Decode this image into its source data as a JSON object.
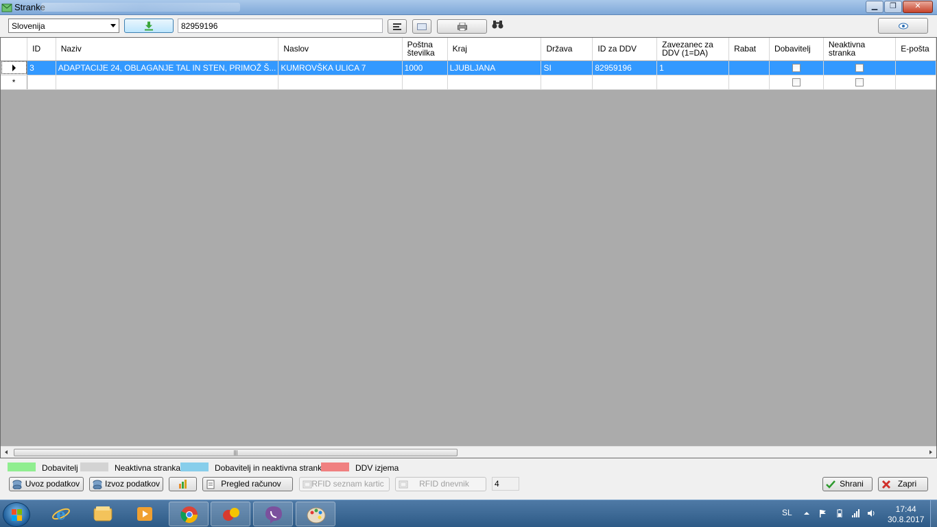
{
  "window": {
    "title": "Stranke"
  },
  "toolbar": {
    "country_value": "Slovenija",
    "search_value": "82959196"
  },
  "grid": {
    "columns": [
      "ID",
      "Naziv",
      "Naslov",
      "Poštna številka",
      "Kraj",
      "Država",
      "ID za DDV",
      "Zavezanec za DDV (1=DA)",
      "Rabat",
      "Dobavitelj",
      "Neaktivna stranka",
      "E-pošta"
    ],
    "rows": [
      {
        "id": "3",
        "naziv": "ADAPTACIJE 24, OBLAGANJE TAL IN STEN, PRIMOŽ Š...",
        "naslov": "KUMROVŠKA ULICA 7",
        "postna": "1000",
        "kraj": "LJUBLJANA",
        "drzava": "SI",
        "id_ddv": "82959196",
        "zavezanec": "1",
        "rabat": ""
      }
    ],
    "new_row_marker": "*"
  },
  "legend": [
    {
      "label": "Dobavitelj",
      "color": "#90ee90"
    },
    {
      "label": "Neaktivna stranka",
      "color": "#d3d3d3"
    },
    {
      "label": "Dobavitelj in neaktivna stranka",
      "color": "#87ceeb"
    },
    {
      "label": "DDV izjema",
      "color": "#f08080"
    }
  ],
  "buttons": {
    "uvoz": "Uvoz podatkov",
    "izvoz": "Izvoz podatkov",
    "pregled": "Pregled računov",
    "rfid_seznam": "RFID seznam kartic",
    "rfid_dnevnik": "RFID dnevnik",
    "count": "4",
    "shrani": "Shrani",
    "zapri": "Zapri"
  },
  "taskbar": {
    "language": "SL",
    "time": "17:44",
    "date": "30.8.2017",
    "apps": [
      "internet-explorer-icon",
      "file-explorer-icon",
      "media-player-icon",
      "chrome-icon",
      "custom-app-icon",
      "viber-icon",
      "paint-icon"
    ]
  }
}
